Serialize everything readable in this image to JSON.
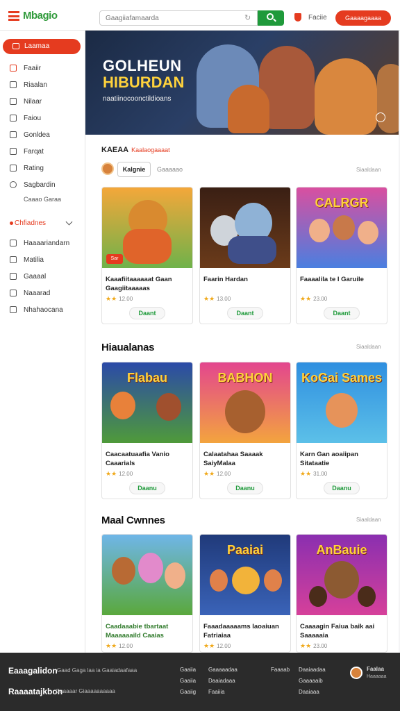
{
  "header": {
    "logo": "Mbagio",
    "search_placeholder": "Gaagiiafamaarda",
    "link": "Faciie",
    "signup_label": "Gaaaagaaaa"
  },
  "sidebar": {
    "active_label": "Laamaa",
    "items": [
      {
        "label": "Faaiir"
      },
      {
        "label": "Riaalan"
      },
      {
        "label": "Nilaar"
      },
      {
        "label": "Faiou"
      },
      {
        "label": "Gonldea"
      },
      {
        "label": "Farqat"
      },
      {
        "label": "Rating"
      },
      {
        "label": "Sagbardin"
      }
    ],
    "sub_label": "Caaao Garaa",
    "section_label": "Chfiadnes",
    "section_items": [
      {
        "label": "Haaaariandarn"
      },
      {
        "label": "Matilia"
      },
      {
        "label": "Gaaaal"
      },
      {
        "label": "Naaarad"
      },
      {
        "label": "Nhahaocana"
      }
    ]
  },
  "hero": {
    "title": "GOLHEUN",
    "subtitle": "HIBURDAN",
    "description": "naatiinocoonctildioans"
  },
  "section1": {
    "title": "KAEAA",
    "tag": "Kaalaogaaaat",
    "chip": "Kalgnie",
    "chip_label": "Gaaaaao",
    "see_all": "Siaaldaan",
    "cards": [
      {
        "name": "Kaaafiitaaaaaat Gaan Gaagiitaaaaas",
        "rating": "12.00",
        "play": "Daant",
        "badge": "Sar",
        "thumb_title": ""
      },
      {
        "name": "Faarin Hardan",
        "rating": "13.00",
        "play": "Daant",
        "badge": "",
        "thumb_title": ""
      },
      {
        "name": "Faaaalila te I Garuile",
        "rating": "23.00",
        "play": "Daant",
        "badge": "",
        "thumb_title": "CALRGR"
      }
    ]
  },
  "section2": {
    "title": "Hiaualanas",
    "see_all": "Siaaldaan",
    "cards": [
      {
        "name": "Caacaatuaafia Vanio Caaarials",
        "rating": "12.00",
        "play": "Daanu",
        "badge": "",
        "thumb_title": "Flabau"
      },
      {
        "name": "Calaatahaa Saaaak SaiyMalaa",
        "rating": "12.00",
        "play": "Daanu",
        "badge": "",
        "thumb_title": "BABHON"
      },
      {
        "name": "Karn Gan aoaiipan Sitataatie",
        "rating": "31.00",
        "play": "Daanu",
        "badge": "",
        "thumb_title": "KoGai Sames"
      }
    ]
  },
  "section3": {
    "title": "Maal Cwnnes",
    "see_all": "Siaaldaan",
    "cards": [
      {
        "name": "Caadaaabie tbartaat Maaaaaaild Caaias",
        "rating": "12.00",
        "play": "",
        "badge": "",
        "thumb_title": ""
      },
      {
        "name": "Faaadaaaaams Iaoaiuan Fatriaiaa",
        "rating": "12.00",
        "play": "",
        "badge": "",
        "thumb_title": "Paaiai"
      },
      {
        "name": "Caaaagin Faiua baik aai Saaaaaia",
        "rating": "23.00",
        "play": "",
        "badge": "",
        "thumb_title": "AnBauie"
      }
    ]
  },
  "footer": {
    "logo1": "Eaaagalidon",
    "text1": "Gaad Gaga laa ia Gaaiadaafaaa",
    "logo2": "Raaaatajkbon",
    "text2": "Gaaaaar Giaaaaaaaaaa",
    "cols": [
      [
        "Gaaiia",
        "Gaaiia",
        "Gaaiig"
      ],
      [
        "Gaaaaadaa",
        "Daaiadaaa",
        "Faaiiia"
      ],
      [
        "Faaaab"
      ],
      [
        "Daaiaadaa",
        "Gaaaaaib",
        "Daaiaaa"
      ]
    ],
    "user_name": "Faalaa",
    "user_sub": "Haaaaaa"
  },
  "colors": {
    "accent": "#e53b1f",
    "brand_green": "#1f9a3b",
    "footer_bg": "#2b2b2b"
  }
}
